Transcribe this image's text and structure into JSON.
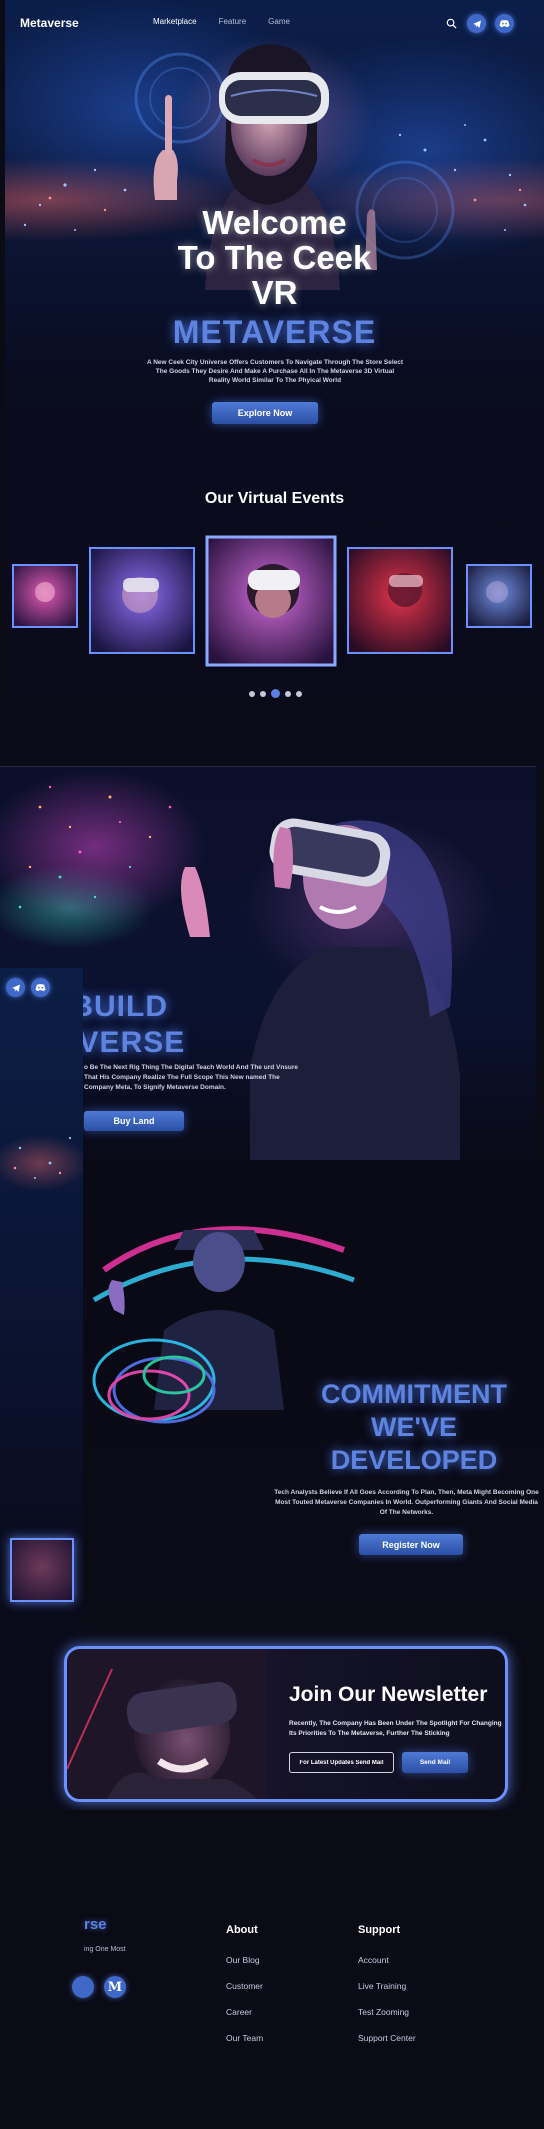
{
  "nav": {
    "logo": "Metaverse",
    "links": [
      "Marketplace",
      "Feature",
      "Game"
    ]
  },
  "hero": {
    "title_line1": "Welcome",
    "title_line2": "To The Ceek",
    "title_line3": "VR",
    "title_highlight": "METAVERSE",
    "subtitle": "A New Ceek City Universe Offers Customers To Navigate Through The Store Select The Goods They Desire And Make A Purchase All In The Metaverse 3D Virtual Reality World Similar To The Phyical World",
    "cta": "Explore Now"
  },
  "events": {
    "title": "Our Virtual Events",
    "slide_count": 5,
    "active_index": 2
  },
  "build": {
    "title_line1": "VE BUILD",
    "title_line2": "ETAVERSE",
    "subtitle": "o Be The Next Rig Thing The Digital Teach World And The urd Vnsure That His Company Realize The Full Scope This New named The Company Meta, To Signify Metaverse Domain.",
    "cta": "Buy Land"
  },
  "commitment": {
    "title_line1": "COMMITMENT",
    "title_line2": "WE'VE",
    "title_line3": "DEVELOPED",
    "subtitle": "Tech Analysts Believe If All Goes According To Plan, Then, Meta Might Becoming One Most Touted Metaverse Companies In World. Outperforming Giants And Social Media Of The Networks.",
    "cta": "Register Now"
  },
  "newsletter": {
    "title": "Join Our Newsletter",
    "subtitle": "Recently, The Company Has Been Under The Spotlight For Changing Its Priorities To The Metaverse, Further The Sticking",
    "input_placeholder": "For Latest Updates Send Mail",
    "cta": "Send Mail"
  },
  "footer": {
    "brand": "rse",
    "brand_sub": "ing One Most",
    "social_letter": "M",
    "about": {
      "heading": "About",
      "links": [
        "Our Blog",
        "Customer",
        "Career",
        "Our Team"
      ]
    },
    "support": {
      "heading": "Support",
      "links": [
        "Account",
        "Live Training",
        "Test Zooming",
        "Support Center"
      ]
    }
  },
  "colors": {
    "accent": "#5b82e0",
    "button": "#3f68c8",
    "background": "#0b0b16"
  },
  "icons": [
    "search-icon",
    "telegram-icon",
    "discord-icon"
  ]
}
